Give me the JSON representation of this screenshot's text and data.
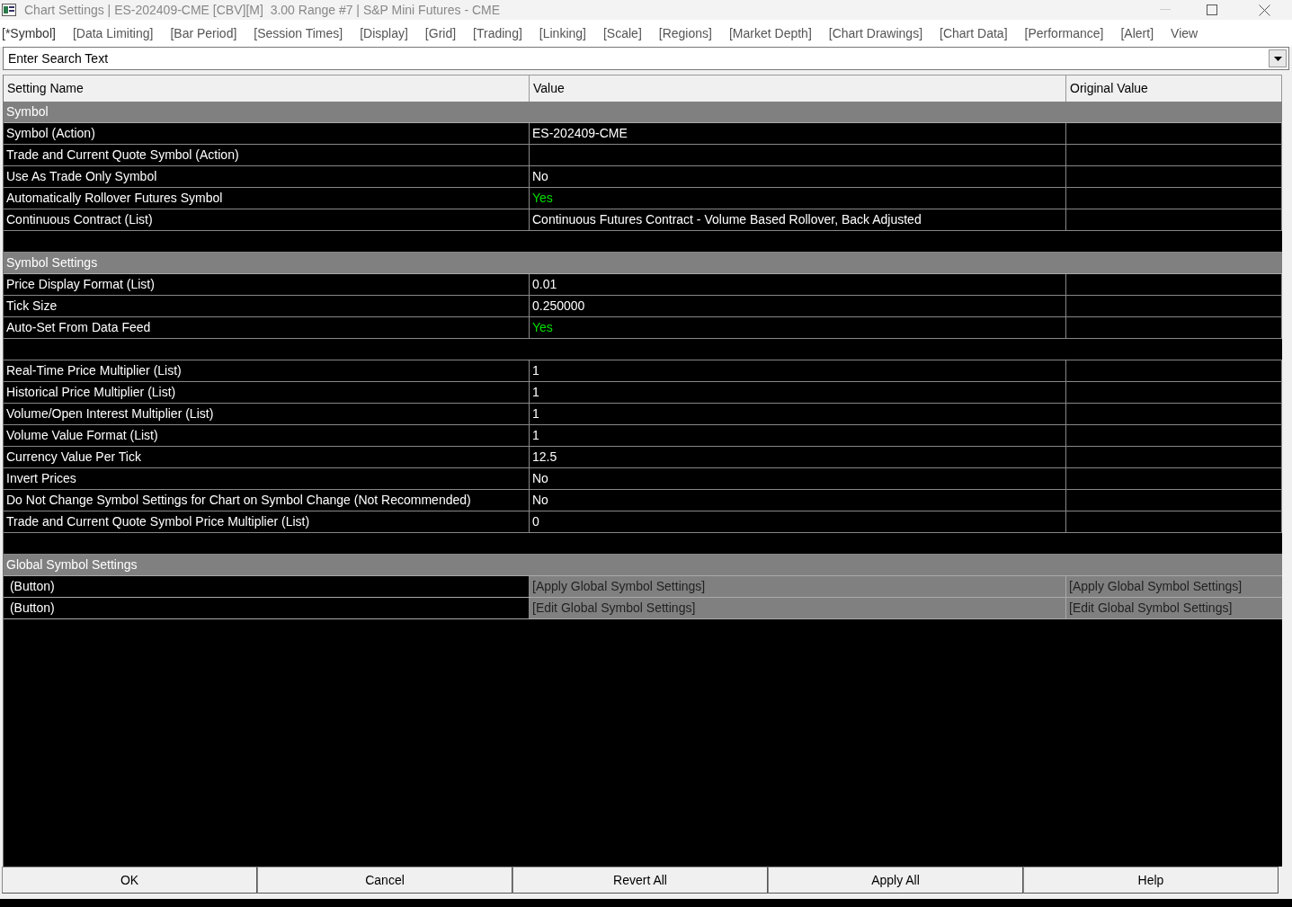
{
  "window": {
    "title": "Chart Settings | ES-202409-CME [CBV][M]  3.00 Range #7 | S&P Mini Futures - CME"
  },
  "tabs": [
    {
      "label": "[*Symbol]",
      "selected": true
    },
    {
      "label": "[Data Limiting]",
      "selected": false
    },
    {
      "label": "[Bar Period]",
      "selected": false
    },
    {
      "label": "[Session Times]",
      "selected": false
    },
    {
      "label": "[Display]",
      "selected": false
    },
    {
      "label": "[Grid]",
      "selected": false
    },
    {
      "label": "[Trading]",
      "selected": false
    },
    {
      "label": "[Linking]",
      "selected": false
    },
    {
      "label": "[Scale]",
      "selected": false
    },
    {
      "label": "[Regions]",
      "selected": false
    },
    {
      "label": "[Market Depth]",
      "selected": false
    },
    {
      "label": "[Chart Drawings]",
      "selected": false
    },
    {
      "label": "[Chart Data]",
      "selected": false
    },
    {
      "label": "[Performance]",
      "selected": false
    },
    {
      "label": "[Alert]",
      "selected": false
    },
    {
      "label": "View",
      "selected": false
    }
  ],
  "search": {
    "placeholder": "Enter Search Text"
  },
  "table": {
    "columns": [
      "Setting Name",
      "Value",
      "Original Value"
    ],
    "rows": [
      {
        "kind": "section",
        "name": "Symbol"
      },
      {
        "kind": "setting",
        "name": "Symbol (Action)",
        "value": "ES-202409-CME",
        "highlighted": false
      },
      {
        "kind": "setting",
        "name": "Trade and Current Quote Symbol (Action)"
      },
      {
        "kind": "setting",
        "name": "Use As Trade Only Symbol",
        "value": "No",
        "highlighted": false
      },
      {
        "kind": "setting",
        "name": "Automatically Rollover Futures Symbol",
        "value": "Yes",
        "highlighted": true
      },
      {
        "kind": "setting",
        "name": "Continuous Contract (List)",
        "value": "Continuous Futures Contract - Volume Based Rollover, Back Adjusted",
        "highlighted": false
      },
      {
        "kind": "blank"
      },
      {
        "kind": "section",
        "name": "Symbol Settings"
      },
      {
        "kind": "setting",
        "name": "Price Display Format (List)",
        "value": "0.01",
        "highlighted": false
      },
      {
        "kind": "setting",
        "name": "Tick Size",
        "value": "0.250000",
        "highlighted": false
      },
      {
        "kind": "setting",
        "name": "Auto-Set From Data Feed",
        "value": "Yes",
        "highlighted": true
      },
      {
        "kind": "blank"
      },
      {
        "kind": "setting",
        "name": "Real-Time Price Multiplier (List)",
        "value": "1",
        "highlighted": false
      },
      {
        "kind": "setting",
        "name": "Historical Price Multiplier (List)",
        "value": "1",
        "highlighted": false
      },
      {
        "kind": "setting",
        "name": "Volume/Open Interest Multiplier (List)",
        "value": "1",
        "highlighted": false
      },
      {
        "kind": "setting",
        "name": "Volume Value Format (List)",
        "value": "1",
        "highlighted": false
      },
      {
        "kind": "setting",
        "name": "Currency Value Per Tick",
        "value": "12.5",
        "highlighted": false
      },
      {
        "kind": "setting",
        "name": "Invert Prices",
        "value": "No",
        "highlighted": false
      },
      {
        "kind": "setting",
        "name": "Do Not Change Symbol Settings for Chart on Symbol Change (Not Recommended)",
        "value": "No",
        "highlighted": false
      },
      {
        "kind": "setting",
        "name": "Trade and Current Quote Symbol Price Multiplier (List)",
        "value": "0",
        "highlighted": false
      },
      {
        "kind": "blank"
      },
      {
        "kind": "section",
        "name": "Global Symbol Settings"
      },
      {
        "kind": "button",
        "name": " (Button)",
        "value": "[Apply Global Symbol Settings]",
        "original": "[Apply Global Symbol Settings]"
      },
      {
        "kind": "button",
        "name": " (Button)",
        "value": "[Edit Global Symbol Settings]",
        "original": "[Edit Global Symbol Settings]"
      }
    ]
  },
  "buttons": [
    "OK",
    "Cancel",
    "Revert All",
    "Apply All",
    "Help"
  ]
}
